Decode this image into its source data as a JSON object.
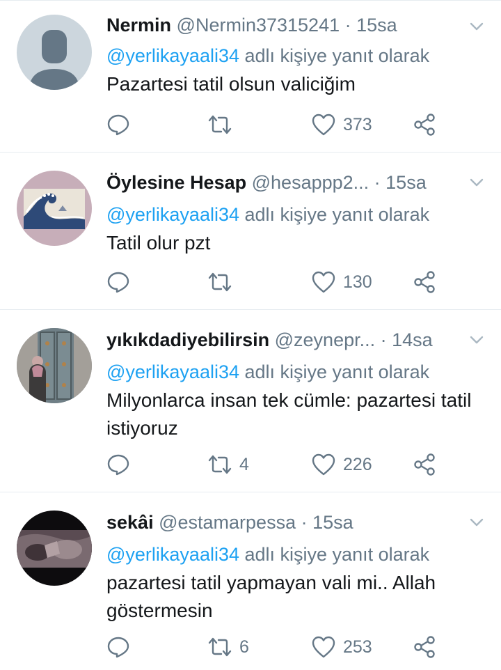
{
  "tweets": [
    {
      "name": "Nermin",
      "handle": "@Nermin37315241",
      "time": "· 15sa",
      "reply_mention": "@yerlikayaali34",
      "reply_suffix": " adlı kişiye yanıt olarak",
      "text": "Pazartesi tatil olsun valiciğim",
      "retweets": "",
      "likes": "373",
      "avatar": "default-profile-avatar"
    },
    {
      "name": "Öylesine Hesap",
      "handle": "@hesappp2...",
      "time": " · 15sa",
      "reply_mention": "@yerlikayaali34",
      "reply_suffix": " adlı kişiye yanıt olarak",
      "text": "Tatil olur pzt",
      "retweets": "",
      "likes": "130",
      "avatar": "great-wave-avatar"
    },
    {
      "name": "yıkıkdadiyebilirsin",
      "handle": "@zeynepr...",
      "time": " · 14sa",
      "reply_mention": "@yerlikayaali34",
      "reply_suffix": " adlı kişiye yanıt olarak",
      "text": "Milyonlarca insan tek cümle: pazartesi tatil istiyoruz",
      "retweets": "4",
      "likes": "226",
      "avatar": "door-photo-avatar"
    },
    {
      "name": "sekâi",
      "handle": "@estamarpessa",
      "time": "· 15sa",
      "reply_mention": "@yerlikayaali34",
      "reply_suffix": " adlı kişiye yanıt olarak",
      "text": "pazartesi tatil yapmayan vali mi.. Allah göstermesin",
      "retweets": "6",
      "likes": "253",
      "avatar": "dark-photo-avatar"
    }
  ],
  "colors": {
    "link": "#1da1f2",
    "secondary": "#657786",
    "primary": "#14171a",
    "divider": "#e6ecf0"
  }
}
